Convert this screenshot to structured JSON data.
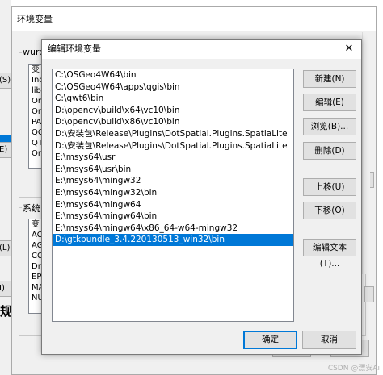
{
  "background_window": {
    "title": "环境变量",
    "user_vars_label": "wurd",
    "system_vars_label": "系统",
    "user_list": [
      "变",
      "Inc",
      "lib",
      "On",
      "Or",
      "PA",
      "QC",
      "QT",
      "Or"
    ],
    "system_list": [
      "变",
      "AC",
      "AG",
      "CC",
      "Dr",
      "EP",
      "MA",
      "NU"
    ],
    "ok_label": "确定",
    "cancel_label": "取消"
  },
  "left_strip": {
    "btn1": "(S).",
    "btn2": "E)",
    "btn3": "(L).",
    "btn4": "I)",
    "big_char": "规"
  },
  "dialog": {
    "title": "编辑环境变量",
    "close_glyph": "✕",
    "paths": [
      "C:\\OSGeo4W64\\bin",
      "C:\\OSGeo4W64\\apps\\qgis\\bin",
      "C:\\qwt6\\bin",
      "D:\\opencv\\build\\x64\\vc10\\bin",
      "D:\\opencv\\build\\x86\\vc10\\bin",
      "D:\\安装包\\Release\\Plugins\\DotSpatial.Plugins.SpatiaLite",
      "D:\\安装包\\Release\\Plugins\\DotSpatial.Plugins.SpatiaLite",
      "E:\\msys64\\usr",
      "E:\\msys64\\usr\\bin",
      "E:\\msys64\\mingw32",
      "E:\\msys64\\mingw32\\bin",
      "E:\\msys64\\mingw64",
      "E:\\msys64\\mingw64\\bin",
      "E:\\msys64\\mingw64\\x86_64-w64-mingw32",
      "D:\\gtkbundle_3.4.220130513_win32\\bin"
    ],
    "buttons": {
      "new": "新建(N)",
      "edit": "编辑(E)",
      "browse": "浏览(B)...",
      "delete": "删除(D)",
      "move_up": "上移(U)",
      "move_down": "下移(O)",
      "edit_text": "编辑文本(T)...",
      "ok": "确定",
      "cancel": "取消"
    }
  },
  "watermark": "CSDN @漂安Ai"
}
